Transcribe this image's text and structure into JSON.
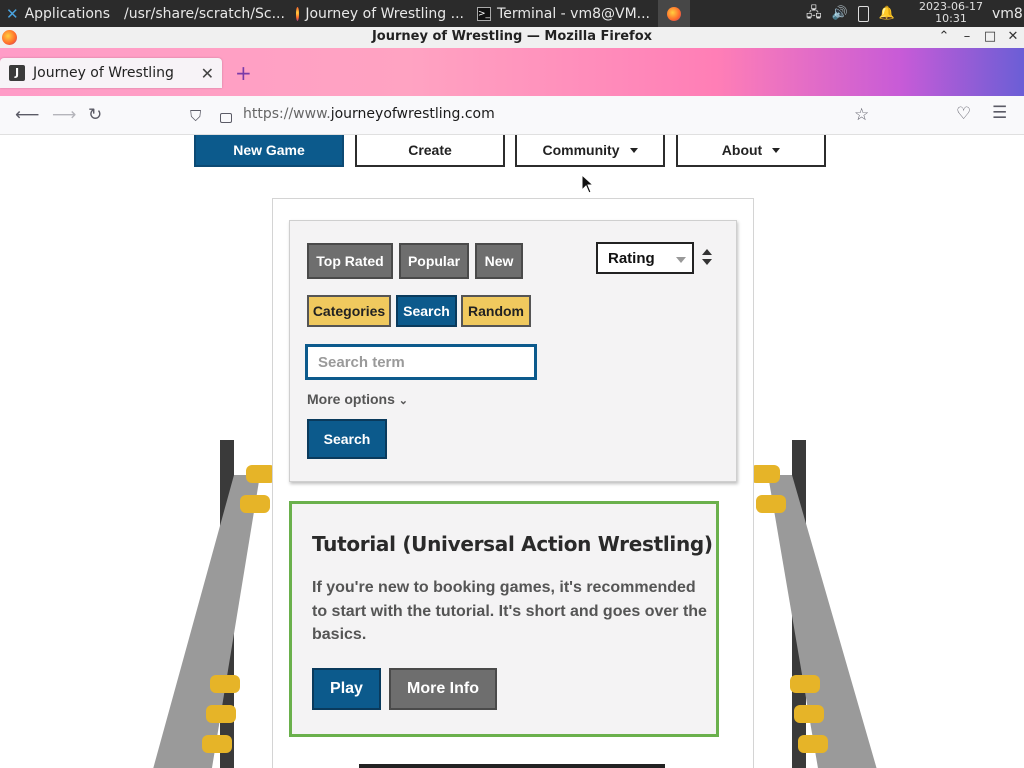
{
  "taskbar": {
    "applications_label": "Applications",
    "tasks": [
      {
        "label": "/usr/share/scratch/Sc..."
      },
      {
        "label": "Journey of Wrestling ..."
      },
      {
        "label": "Terminal - vm8@VM..."
      }
    ],
    "clock": {
      "date": "2023-06-17",
      "time": "10:31"
    },
    "user": "vm8"
  },
  "window": {
    "title": "Journey of Wrestling — Mozilla Firefox"
  },
  "browser": {
    "tab_title": "Journey of Wrestling",
    "tab_favicon_letter": "J",
    "url_prefix": "https://www.",
    "url_domain": "journeyofwrestling.com"
  },
  "site_nav": {
    "items": [
      {
        "label": "New Game"
      },
      {
        "label": "Create"
      },
      {
        "label": "Community"
      },
      {
        "label": "About"
      }
    ]
  },
  "filters": {
    "sort_tabs": [
      {
        "label": "Top Rated"
      },
      {
        "label": "Popular"
      },
      {
        "label": "New"
      }
    ],
    "mode_tabs": [
      {
        "label": "Categories"
      },
      {
        "label": "Search"
      },
      {
        "label": "Random"
      }
    ],
    "sort_select": {
      "value": "Rating"
    },
    "search_placeholder": "Search term",
    "more_options": "More options",
    "search_button": "Search"
  },
  "tutorial": {
    "title": "Tutorial (Universal Action Wrestling)",
    "description": "If you're new to booking games, it's recommended to start with the tutorial. It's short and goes over the basics.",
    "play_button": "Play",
    "more_info_button": "More Info"
  },
  "colors": {
    "primary_blue": "#0c5a8c",
    "yellow": "#f0c95e",
    "green_border": "#6ab04c"
  }
}
